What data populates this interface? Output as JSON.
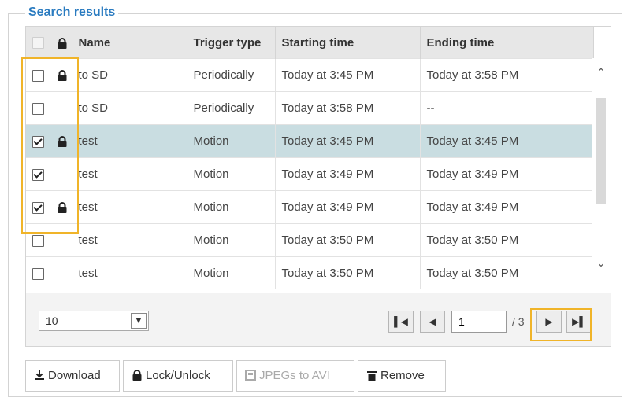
{
  "panel": {
    "title": "Search results"
  },
  "table": {
    "headers": {
      "name": "Name",
      "trigger": "Trigger type",
      "start": "Starting time",
      "end": "Ending time"
    },
    "rows": [
      {
        "checked": false,
        "locked": true,
        "selected": false,
        "name": "to SD",
        "trigger": "Periodically",
        "start": "Today at 3:45 PM",
        "end": "Today at 3:58 PM"
      },
      {
        "checked": false,
        "locked": false,
        "selected": false,
        "name": "to SD",
        "trigger": "Periodically",
        "start": "Today at 3:58 PM",
        "end": "--"
      },
      {
        "checked": true,
        "locked": true,
        "selected": true,
        "name": "test",
        "trigger": "Motion",
        "start": "Today at 3:45 PM",
        "end": "Today at 3:45 PM"
      },
      {
        "checked": true,
        "locked": false,
        "selected": false,
        "name": "test",
        "trigger": "Motion",
        "start": "Today at 3:49 PM",
        "end": "Today at 3:49 PM"
      },
      {
        "checked": true,
        "locked": true,
        "selected": false,
        "name": "test",
        "trigger": "Motion",
        "start": "Today at 3:49 PM",
        "end": "Today at 3:49 PM"
      },
      {
        "checked": false,
        "locked": false,
        "selected": false,
        "name": "test",
        "trigger": "Motion",
        "start": "Today at 3:50 PM",
        "end": "Today at 3:50 PM"
      },
      {
        "checked": false,
        "locked": false,
        "selected": false,
        "name": "test",
        "trigger": "Motion",
        "start": "Today at 3:50 PM",
        "end": "Today at 3:50 PM"
      }
    ]
  },
  "pager": {
    "page_size": "10",
    "current_page": "1",
    "total_label": "/ 3",
    "icons": {
      "first": "first-page-icon",
      "prev": "previous-page-icon",
      "next": "next-page-icon",
      "last": "last-page-icon"
    }
  },
  "actions": {
    "download": "Download",
    "lock": "Lock/Unlock",
    "jpegs": "JPEGs to AVI",
    "remove": "Remove"
  },
  "colors": {
    "title": "#2a7bc0",
    "selected_row": "#c9dde1",
    "highlight": "#f0b429",
    "header_bg": "#e7e7e7"
  }
}
